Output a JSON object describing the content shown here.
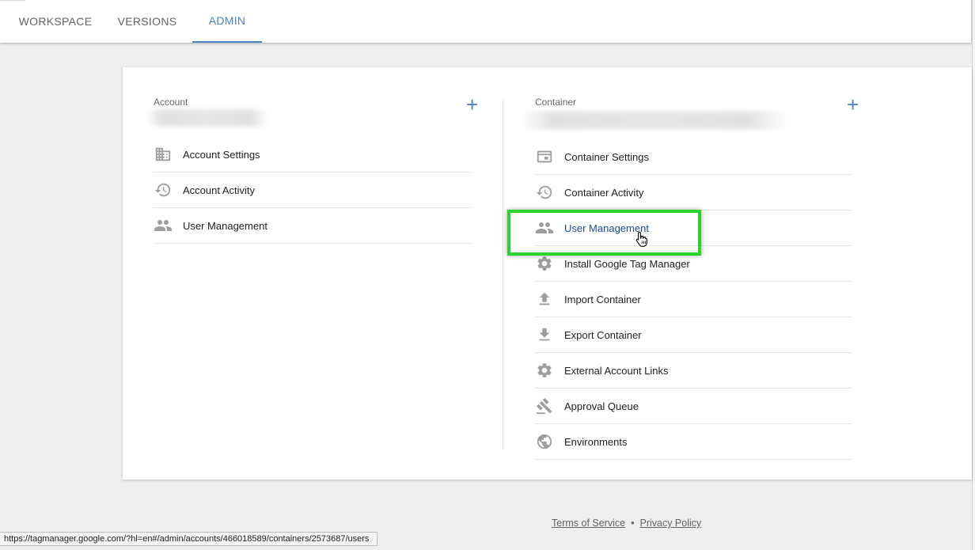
{
  "tabs": [
    {
      "label": "WORKSPACE",
      "active": false
    },
    {
      "label": "VERSIONS",
      "active": false
    },
    {
      "label": "ADMIN",
      "active": true
    }
  ],
  "account": {
    "label": "Account",
    "add_icon": "plus-icon",
    "items": [
      {
        "label": "Account Settings",
        "icon": "building-icon"
      },
      {
        "label": "Account Activity",
        "icon": "history-icon"
      },
      {
        "label": "User Management",
        "icon": "people-icon"
      }
    ]
  },
  "container": {
    "label": "Container",
    "add_icon": "plus-icon",
    "items": [
      {
        "label": "Container Settings",
        "icon": "window-icon"
      },
      {
        "label": "Container Activity",
        "icon": "history-icon"
      },
      {
        "label": "User Management",
        "icon": "people-icon",
        "hovered": true
      },
      {
        "label": "Install Google Tag Manager",
        "icon": "gear-icon"
      },
      {
        "label": "Import Container",
        "icon": "upload-icon"
      },
      {
        "label": "Export Container",
        "icon": "download-icon"
      },
      {
        "label": "External Account Links",
        "icon": "gear-icon"
      },
      {
        "label": "Approval Queue",
        "icon": "gavel-icon"
      },
      {
        "label": "Environments",
        "icon": "globe-icon"
      }
    ]
  },
  "footer": {
    "terms": "Terms of Service",
    "separator": "•",
    "privacy": "Privacy Policy"
  },
  "status_url": "https://tagmanager.google.com/?hl=en#/admin/accounts/466018589/containers/2573687/users",
  "colors": {
    "accent": "#4a86c8",
    "highlight": "#2dd32d",
    "link_hover": "#1a4a97"
  }
}
